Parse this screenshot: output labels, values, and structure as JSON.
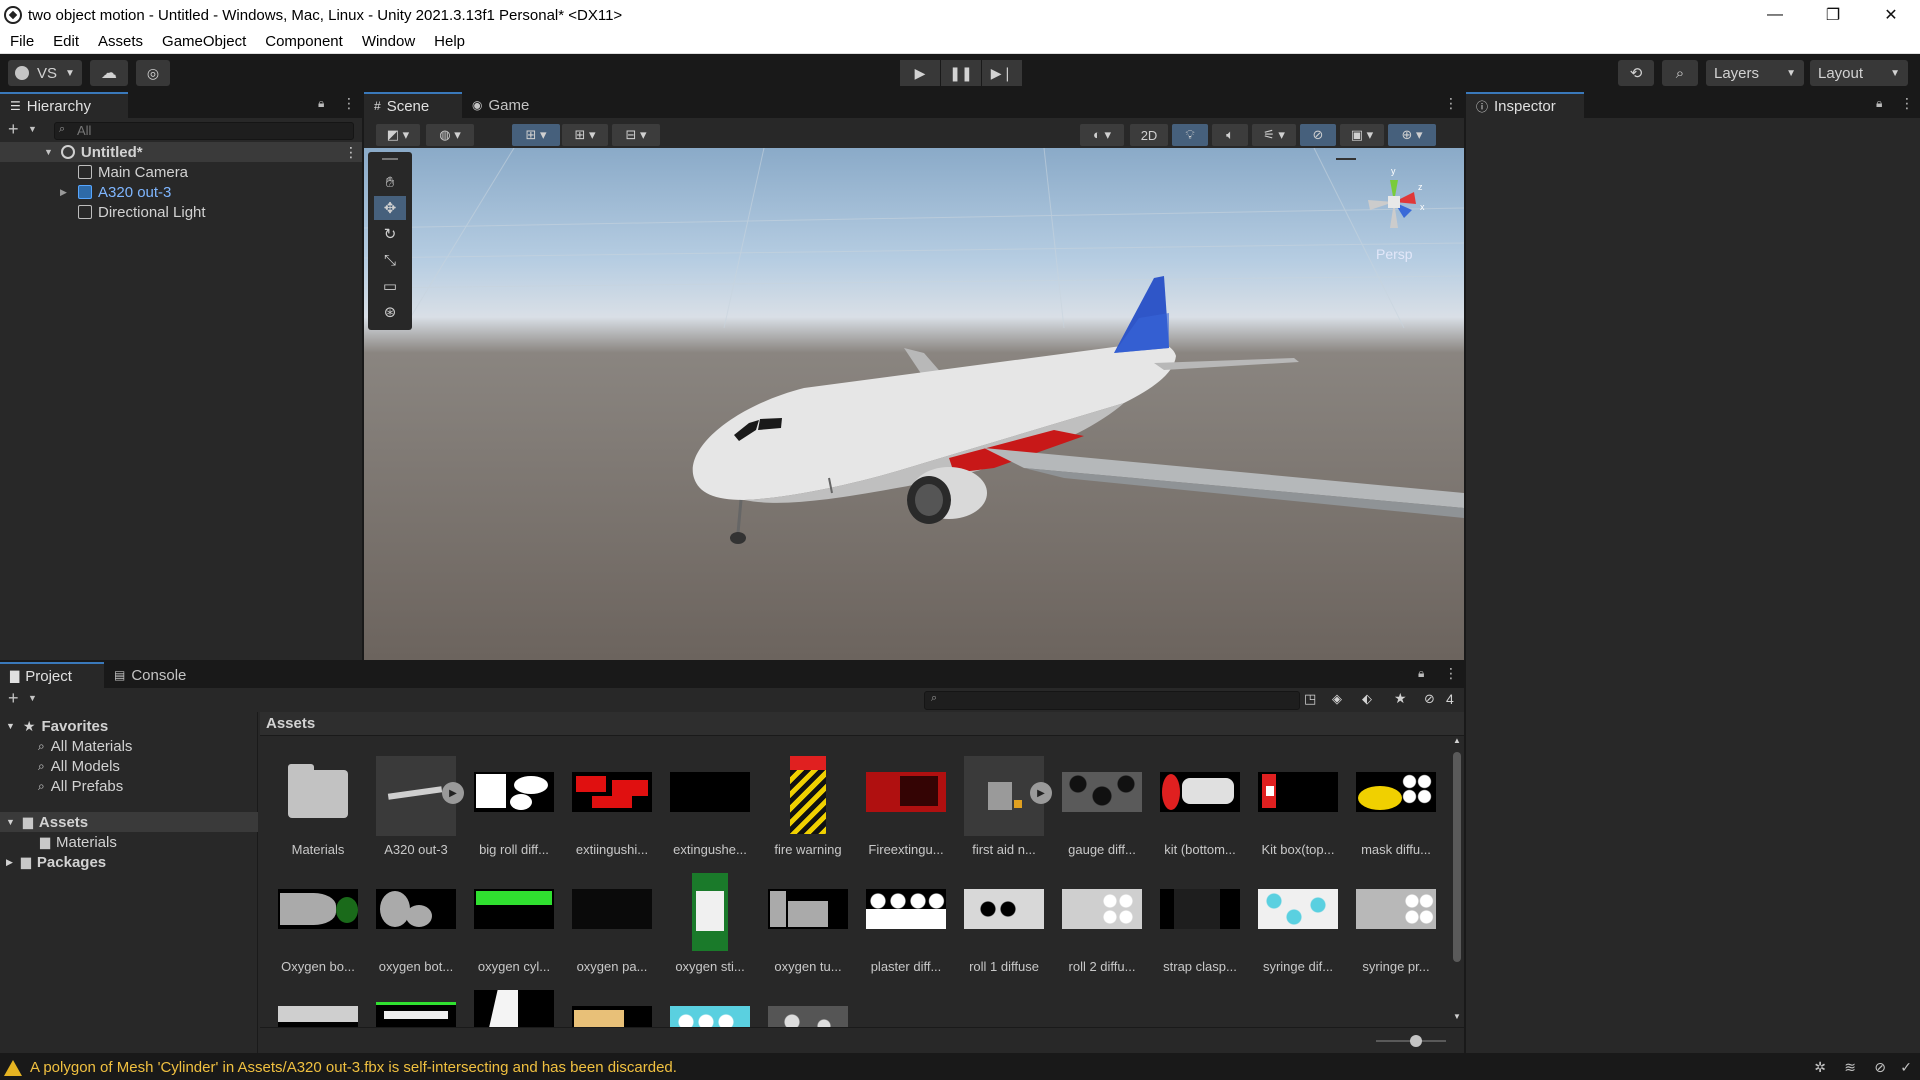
{
  "window": {
    "title": "two object motion - Untitled - Windows, Mac, Linux - Unity 2021.3.13f1 Personal* <DX11>",
    "minimize_glyph": "—",
    "restore_glyph": "❐",
    "close_glyph": "✕"
  },
  "menu": [
    "File",
    "Edit",
    "Assets",
    "GameObject",
    "Component",
    "Window",
    "Help"
  ],
  "toolbar": {
    "account_label": "VS",
    "layers_label": "Layers",
    "layout_label": "Layout"
  },
  "hierarchy": {
    "tab_label": "Hierarchy",
    "search_placeholder": "All",
    "scene_name": "Untitled*",
    "items": [
      {
        "label": "Main Camera"
      },
      {
        "label": "A320 out-3"
      },
      {
        "label": "Directional Light"
      }
    ]
  },
  "scene": {
    "tabs": [
      "Scene",
      "Game"
    ],
    "toggle_2d": "2D",
    "persp_label": "Persp",
    "gizmo_axes": [
      "y",
      "z",
      "x"
    ]
  },
  "inspector": {
    "tab_label": "Inspector"
  },
  "project": {
    "tabs": [
      "Project",
      "Console"
    ],
    "favorites_label": "Favorites",
    "favorites": [
      "All Materials",
      "All Models",
      "All Prefabs"
    ],
    "assets_label": "Assets",
    "asset_folders": [
      "Materials"
    ],
    "packages_label": "Packages",
    "breadcrumb": "Assets",
    "hidden_count": "4",
    "assets": [
      "Materials",
      "A320 out-3",
      "big roll diff...",
      "extiingushi...",
      "extingushe...",
      "fire warning",
      "Fireextingu...",
      "first aid n...",
      "gauge diff...",
      "kit (bottom...",
      "Kit box(top...",
      "mask diffu...",
      "Oxygen bo...",
      "oxygen bot...",
      "oxygen cyl...",
      "oxygen pa...",
      "oxygen sti...",
      "oxygen tu...",
      "plaster diff...",
      "roll 1 diffuse",
      "roll 2 diffu...",
      "strap clasp...",
      "syringe  dif...",
      "syringe pr..."
    ]
  },
  "status": {
    "message": "A polygon of Mesh 'Cylinder' in Assets/A320 out-3.fbx is self-intersecting and has been discarded."
  }
}
